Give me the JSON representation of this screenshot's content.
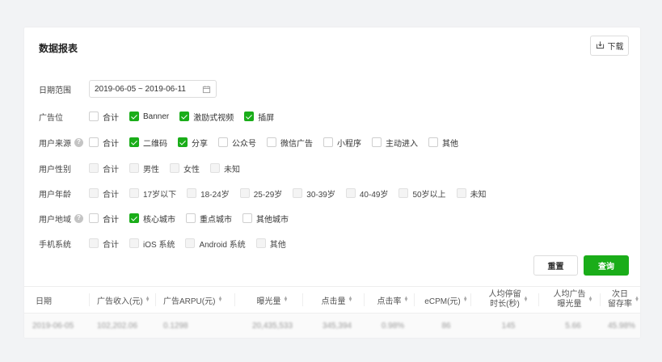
{
  "report": {
    "title": "数据报表",
    "download_label": "下载"
  },
  "filters": {
    "date_range": {
      "label": "日期范围",
      "value": "2019-06-05 ~ 2019-06-11"
    },
    "ad_slot": {
      "label": "广告位",
      "options": [
        {
          "label": "合计",
          "checked": false
        },
        {
          "label": "Banner",
          "checked": true
        },
        {
          "label": "激励式视频",
          "checked": true
        },
        {
          "label": "插屏",
          "checked": true
        }
      ]
    },
    "user_source": {
      "label": "用户来源",
      "options": [
        {
          "label": "合计",
          "checked": false
        },
        {
          "label": "二维码",
          "checked": true
        },
        {
          "label": "分享",
          "checked": true
        },
        {
          "label": "公众号",
          "checked": false
        },
        {
          "label": "微信广告",
          "checked": false
        },
        {
          "label": "小程序",
          "checked": false
        },
        {
          "label": "主动进入",
          "checked": false
        },
        {
          "label": "其他",
          "checked": false
        }
      ]
    },
    "user_gender": {
      "label": "用户性别",
      "options": [
        {
          "label": "合计",
          "checked": false
        },
        {
          "label": "男性",
          "checked": false
        },
        {
          "label": "女性",
          "checked": false
        },
        {
          "label": "未知",
          "checked": false
        }
      ]
    },
    "user_age": {
      "label": "用户年龄",
      "options": [
        {
          "label": "合计",
          "checked": false
        },
        {
          "label": "17岁以下",
          "checked": false
        },
        {
          "label": "18-24岁",
          "checked": false
        },
        {
          "label": "25-29岁",
          "checked": false
        },
        {
          "label": "30-39岁",
          "checked": false
        },
        {
          "label": "40-49岁",
          "checked": false
        },
        {
          "label": "50岁以上",
          "checked": false
        },
        {
          "label": "未知",
          "checked": false
        }
      ]
    },
    "user_region": {
      "label": "用户地域",
      "options": [
        {
          "label": "合计",
          "checked": false
        },
        {
          "label": "核心城市",
          "checked": true
        },
        {
          "label": "重点城市",
          "checked": false
        },
        {
          "label": "其他城市",
          "checked": false
        }
      ]
    },
    "os": {
      "label": "手机系统",
      "options": [
        {
          "label": "合计",
          "checked": false
        },
        {
          "label": "iOS 系统",
          "checked": false
        },
        {
          "label": "Android 系统",
          "checked": false
        },
        {
          "label": "其他",
          "checked": false
        }
      ]
    }
  },
  "actions": {
    "reset_label": "重置",
    "query_label": "查询"
  },
  "table": {
    "headers": [
      {
        "label": "日期"
      },
      {
        "label": "广告收入(元)"
      },
      {
        "label": "广告ARPU(元)"
      },
      {
        "label": "曝光量"
      },
      {
        "label": "点击量"
      },
      {
        "label": "点击率"
      },
      {
        "label": "eCPM(元)"
      },
      {
        "label": "人均停留",
        "label2": "时长(秒)"
      },
      {
        "label": "人均广告",
        "label2": "曝光量"
      },
      {
        "label": "次日",
        "label2": "留存率"
      }
    ],
    "rows": [
      [
        "2019-06-05",
        "102,202.06",
        "0.1298",
        "20,435,533",
        "345,394",
        "0.98%",
        "86",
        "145",
        "5.66",
        "45.98%"
      ]
    ]
  }
}
